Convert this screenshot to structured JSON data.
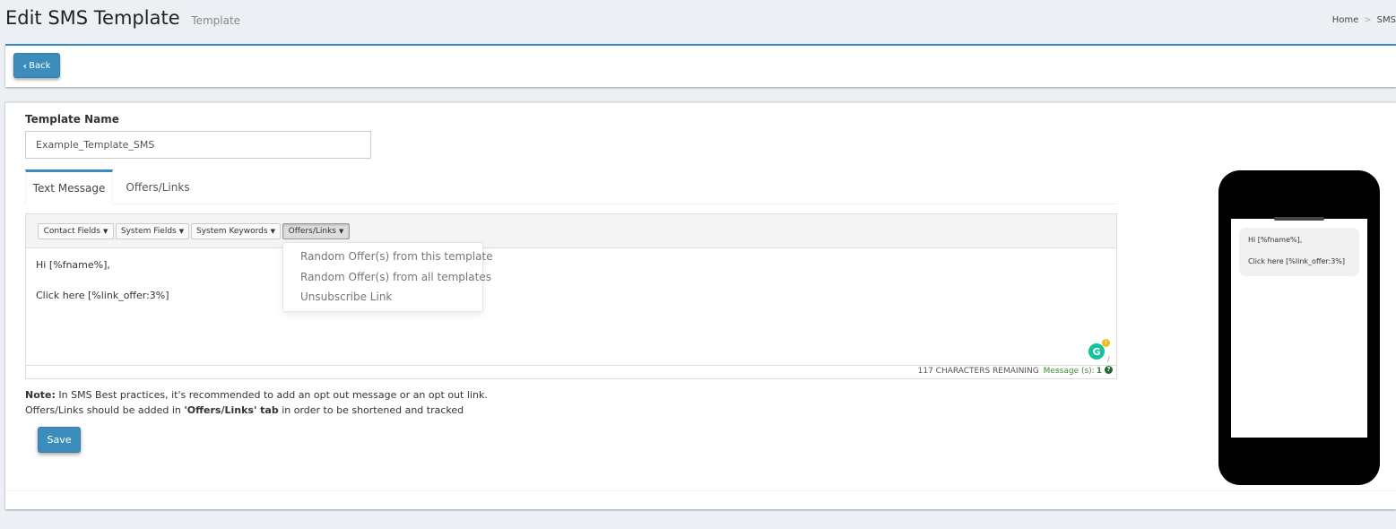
{
  "header": {
    "title": "Edit SMS Template",
    "subtitle": "Template",
    "breadcrumb": [
      "Home",
      "SMS"
    ]
  },
  "toolbar_top": {
    "back_label": "Back"
  },
  "form": {
    "template_name_label": "Template Name",
    "template_name_value": "Example_Template_SMS"
  },
  "tabs": [
    {
      "label": "Text Message",
      "active": true
    },
    {
      "label": "Offers/Links",
      "active": false
    }
  ],
  "editor": {
    "toolbar": [
      {
        "label": "Contact Fields"
      },
      {
        "label": "System Fields"
      },
      {
        "label": "System Keywords"
      },
      {
        "label": "Offers/Links",
        "pressed": true
      }
    ],
    "lines": [
      "Hi [%fname%],",
      "",
      "Click here  [%link_offer:3%]"
    ],
    "dropdown_items": [
      "Random Offer(s) from this template",
      "Random Offer(s) from all templates",
      "Unsubscribe Link"
    ],
    "grammarly_badge": "!",
    "status": {
      "characters_remaining": "117 CHARACTERS REMAINING",
      "messages_label": "Message (s):",
      "messages_count": "1",
      "help_glyph": "?"
    }
  },
  "note": {
    "prefix": "Note:",
    "line1": " In SMS Best practices, it's recommended to add an opt out message or an opt out link.",
    "line2_start": "Offers/Links should be added in ",
    "line2_bold": "'Offers/Links' tab",
    "line2_end": " in order to be shortened and tracked"
  },
  "save_label": "Save",
  "preview": {
    "lines": [
      "Hi [%fname%],",
      "",
      "Click here  [%link_offer:3%]"
    ]
  },
  "colors": {
    "primary": "#3c8dbc",
    "background": "#ecf0f5",
    "grammarly": "#15c39a",
    "message_count": "#3a8a3a"
  }
}
